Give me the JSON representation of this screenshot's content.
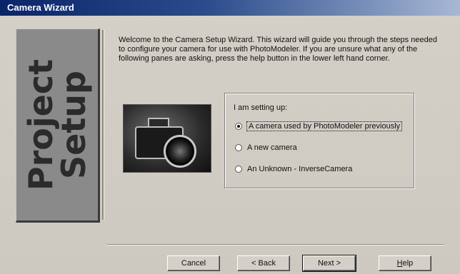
{
  "window": {
    "title": "Camera Wizard"
  },
  "banner": {
    "line1": "Project",
    "line2": "Setup"
  },
  "intro": "Welcome to the Camera Setup Wizard. This wizard will guide you through the steps needed to configure your camera for use with PhotoModeler. If you are unsure what any of the following panes are asking, press the help button in the lower left hand corner.",
  "setup_group": {
    "label": "I am setting up:",
    "options": [
      {
        "label": "A camera used by PhotoModeler previously",
        "selected": true
      },
      {
        "label": "A new camera",
        "selected": false
      },
      {
        "label": "An Unknown - InverseCamera",
        "selected": false
      }
    ]
  },
  "buttons": {
    "cancel": "Cancel",
    "back": "< Back",
    "next": "Next >",
    "help_first": "H",
    "help_rest": "elp"
  },
  "image": {
    "icon": "camera-photo"
  }
}
